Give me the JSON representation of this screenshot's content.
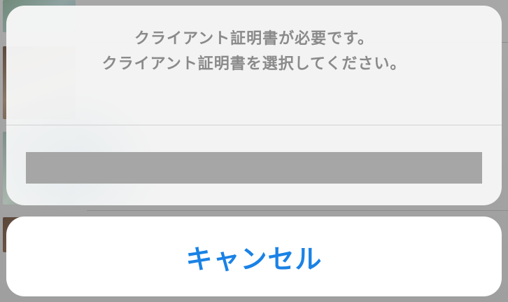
{
  "alert": {
    "message_line1": "クライアント証明書が必要です。",
    "message_line2": "クライアント証明書を選択してください。",
    "certificate_option": ""
  },
  "actions": {
    "cancel_label": "キャンセル"
  },
  "colors": {
    "accent": "#1a82e6",
    "message_text": "#8a8a8a",
    "option_placeholder": "#a6a6a6",
    "sheet_background": "#f6f6f6"
  }
}
